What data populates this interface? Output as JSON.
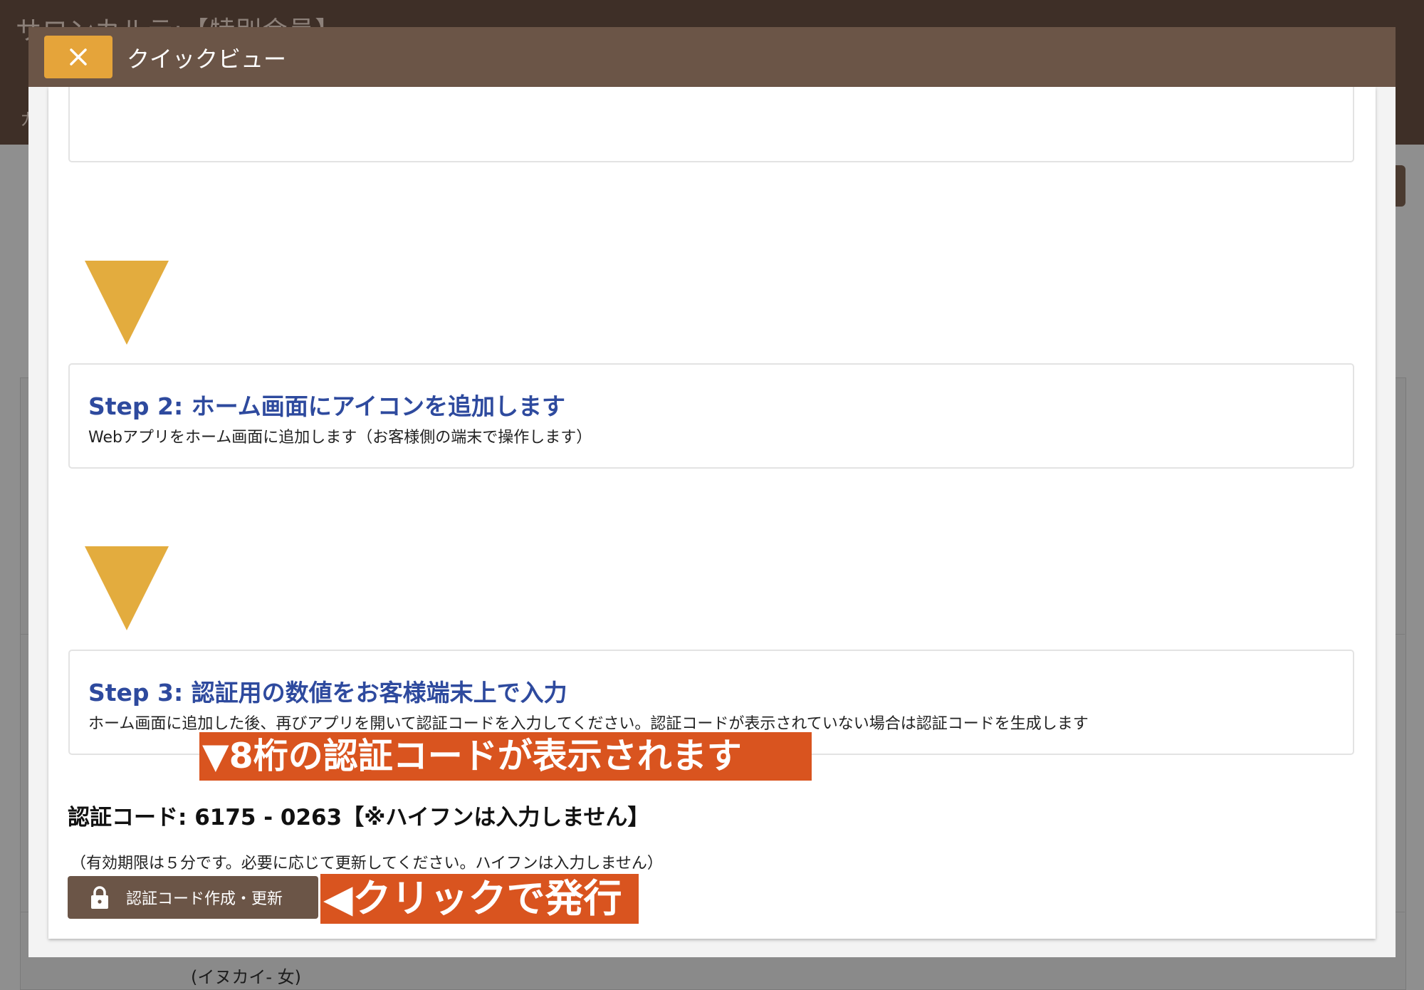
{
  "background": {
    "header_title": "サロンカルテ:【特別会員】",
    "header_sub": "カ",
    "bottom_lines": [
      "(イヌカイ- 女)"
    ]
  },
  "modal": {
    "title": "クイックビュー",
    "close_icon": "close-icon"
  },
  "steps": [
    {
      "title": "Step 2: ホーム画面にアイコンを追加します",
      "description": "Webアプリをホーム画面に追加します（お客様側の端末で操作します）"
    },
    {
      "title": "Step 3: 認証用の数値をお客様端末上で入力",
      "description": "ホーム画面に追加した後、再びアプリを開いて認証コードを入力してください。認証コードが表示されていない場合は認証コードを生成します"
    }
  ],
  "annotations": {
    "code_shown": "▼8桁の認証コードが表示されます",
    "click_to_issue": "◀クリックで発行"
  },
  "auth": {
    "code_text": "認証コード: 6175 - 0263【※ハイフンは入力しません】",
    "validity_note": "（有効期限は５分です。必要に応じて更新してください。ハイフンは入力しません）",
    "button_label": "認証コード作成・更新",
    "button_icon": "lock-icon"
  },
  "colors": {
    "header_brown": "#6b5547",
    "close_orange": "#e5a43a",
    "step_title_blue": "#2e4a9e",
    "arrow_gold": "#e3ac3e",
    "annotation_orange": "#d9541f"
  }
}
